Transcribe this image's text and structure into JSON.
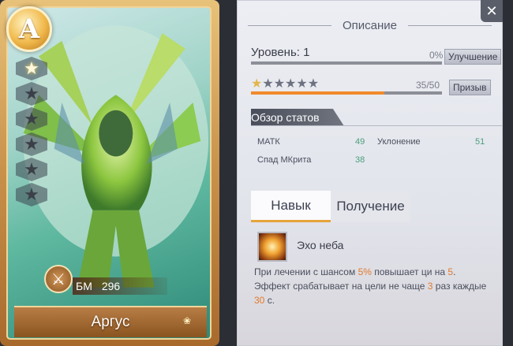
{
  "hero": {
    "rarity": "A",
    "stars_total": 6,
    "stars_filled": 1,
    "power_label": "БМ",
    "power_value": "296",
    "name": "Аргус"
  },
  "panel": {
    "title": "Описание",
    "level_label": "Уровень: 1",
    "level_progress": "0%",
    "level_progress_value": 0,
    "upgrade_button": "Улучшение",
    "star_progress": "35/50",
    "star_progress_value": 0.7,
    "summon_button": "Призыв",
    "stats_header": "Обзор статов",
    "stats": [
      {
        "label": "МАТК",
        "value": "49"
      },
      {
        "label": "Уклонение",
        "value": "51"
      },
      {
        "label": "Спад МКрита",
        "value": "38"
      }
    ],
    "tabs": [
      {
        "label": "Навык",
        "active": true
      },
      {
        "label": "Получение",
        "active": false
      }
    ],
    "skill": {
      "name": "Эхо неба",
      "desc_parts": [
        "При лечении с шансом ",
        "5%",
        " повышает ци на ",
        "5",
        ". Эффект срабатывает на цели не чаще ",
        "3",
        " раз каждые ",
        "30",
        " с."
      ]
    }
  },
  "colors": {
    "accent_orange": "#e27a2b",
    "stat_green": "#4a9e7c",
    "level_bar": "#6fc7c2",
    "star_bar": "#f08a2c"
  }
}
